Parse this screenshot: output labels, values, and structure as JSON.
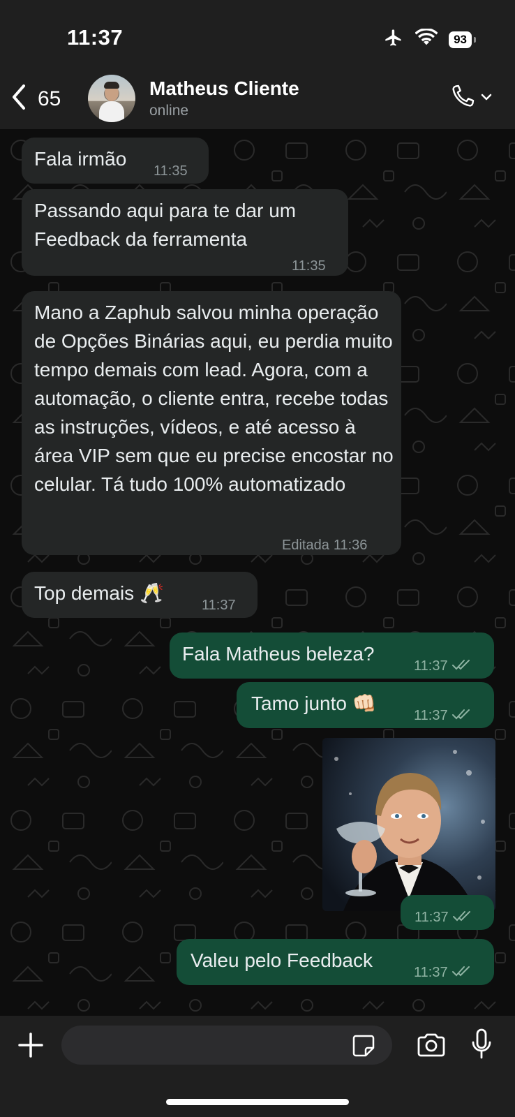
{
  "status_bar": {
    "time": "11:37",
    "battery": "93",
    "icons": [
      "airplane-icon",
      "wifi-icon",
      "battery-icon"
    ]
  },
  "header": {
    "back_count": "65",
    "contact_name": "Matheus Cliente",
    "contact_status": "online",
    "icons": [
      "chevron-left-icon",
      "phone-icon",
      "chevron-down-icon"
    ]
  },
  "messages": [
    {
      "direction": "incoming",
      "text": "Fala irmão",
      "time": "11:35"
    },
    {
      "direction": "incoming",
      "text": "Passando aqui para te dar um Feedback da ferramenta",
      "time": "11:35"
    },
    {
      "direction": "incoming",
      "text": "Mano a Zaphub salvou minha operação de Opções Binárias aqui, eu perdia muito tempo demais com lead. Agora, com a automação, o cliente entra, recebe todas as instruções, vídeos, e até acesso à área VIP sem que eu precise encostar no celular. Tá tudo 100% automatizado",
      "time": "11:36",
      "edited_label": "Editada"
    },
    {
      "direction": "incoming",
      "text": "Top demais 🥂",
      "time": "11:37"
    },
    {
      "direction": "outgoing",
      "text": "Fala Matheus beleza?",
      "time": "11:37",
      "status": "read"
    },
    {
      "direction": "outgoing",
      "text": "Tamo junto 👊🏻",
      "time": "11:37",
      "status": "read"
    },
    {
      "direction": "outgoing",
      "type": "image",
      "time": "11:37",
      "status": "read"
    },
    {
      "direction": "outgoing",
      "text": "Valeu pelo Feedback",
      "time": "11:37",
      "status": "read"
    }
  ],
  "input_bar": {
    "placeholder": "",
    "icons": [
      "plus-icon",
      "sticker-icon",
      "camera-icon",
      "microphone-icon"
    ]
  },
  "colors": {
    "incoming_bubble": "#242626",
    "outgoing_bubble": "#144d37",
    "header_bg": "#1f1f1f",
    "chat_bg": "#0d0d0d",
    "meta_text": "#8d9598"
  }
}
